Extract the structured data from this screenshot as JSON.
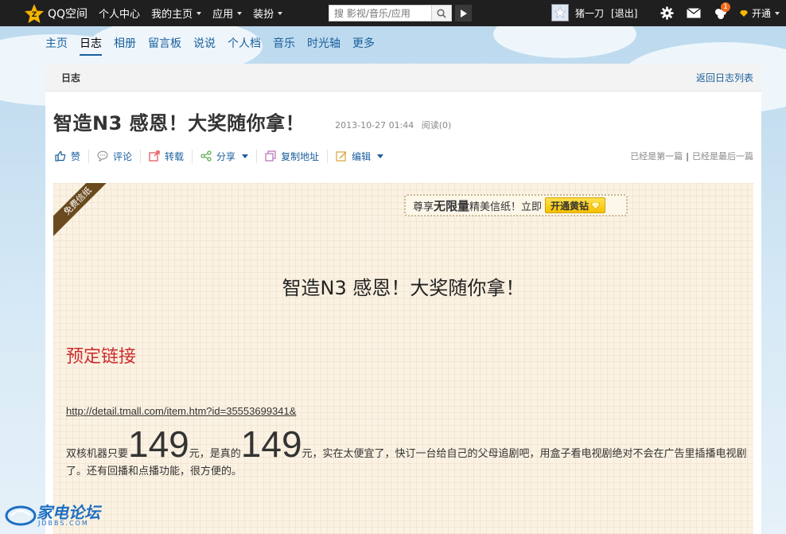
{
  "topbar": {
    "logo_text": "QQ空间",
    "nav": [
      {
        "label": "个人中心",
        "dropdown": false
      },
      {
        "label": "我的主页",
        "dropdown": true
      },
      {
        "label": "应用",
        "dropdown": true
      },
      {
        "label": "装扮",
        "dropdown": true
      }
    ],
    "search_placeholder": "搜 影视/音乐/应用",
    "username": "猪一刀",
    "logout": "[退出]",
    "notify_count": "1",
    "open_label": "开通"
  },
  "subnav": [
    "主页",
    "日志",
    "相册",
    "留言板",
    "说说",
    "个人档",
    "音乐",
    "时光轴",
    "更多"
  ],
  "subnav_active": 1,
  "panel": {
    "header": "日志",
    "back": "返回日志列表"
  },
  "post": {
    "title": "智造N3 感恩！大奖随你拿！",
    "date": "2013-10-27 01:44",
    "reads": "阅读(0)"
  },
  "toolbar": {
    "like": "赞",
    "comment": "评论",
    "repost": "转载",
    "share": "分享",
    "copy": "复制地址",
    "edit": "编辑",
    "first": "已经是第一篇",
    "last": "已经是最后一篇",
    "separator": "|"
  },
  "paper": {
    "ribbon": "免费信纸",
    "promo_prefix": "尊享",
    "promo_bold": "无限量",
    "promo_suffix": "精美信纸！立即",
    "promo_button": "开通黄钻",
    "heading": "智造N3 感恩！大奖随你拿！",
    "subheading": "预定链接",
    "link": "http://detail.tmall.com/item.htm?id=35553699341&",
    "body_1": "双核机器只要",
    "price_1": "149",
    "body_2": "元，是真的",
    "price_2": "149",
    "body_3": "元，实在太便宜了，快订一台给自己的父母追剧吧，用盒子看电视剧绝对不会在广告里插播电视剧了。还有回播和点播功能，很方便的。"
  },
  "watermark": {
    "name": "家电论坛",
    "domain": "JDBBS.COM"
  },
  "colors": {
    "topbar": "#1f1f1f",
    "link": "#1a5e9c",
    "accent_red": "#cc2e2e",
    "paper": "#fbf2e3",
    "yellow": "#f6c100"
  }
}
